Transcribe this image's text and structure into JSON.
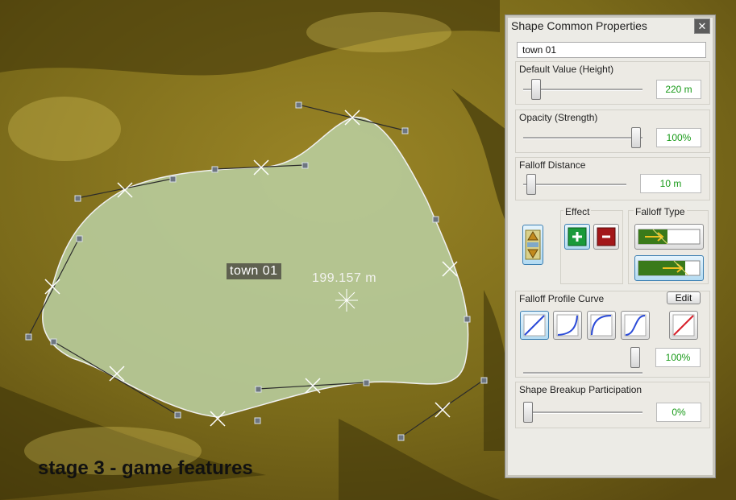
{
  "viewport": {
    "shape_name_tag": "town 01",
    "measurement": "199.157 m",
    "caption": "stage 3 - game features"
  },
  "panel": {
    "title": "Shape Common Properties",
    "close_glyph": "✕",
    "name_value": "town 01",
    "default_value": {
      "label": "Default Value (Height)",
      "value": "220 m",
      "level": 0.08
    },
    "opacity": {
      "label": "Opacity (Strength)",
      "value": "100%",
      "level": 1.0
    },
    "falloff_distance": {
      "label": "Falloff Distance",
      "value": "10 m",
      "level": 0.05
    },
    "effect": {
      "label": "Effect",
      "add_icon": "plus-icon",
      "subtract_icon": "minus-icon"
    },
    "falloff_type": {
      "label": "Falloff Type",
      "selected": "outside"
    },
    "falloff_profile": {
      "label": "Falloff Profile Curve",
      "edit_label": "Edit",
      "curves": [
        "linear",
        "ease-in",
        "ease-out",
        "s-curve",
        "custom"
      ],
      "selected": "linear",
      "value": "100%",
      "level": 1.0
    },
    "shape_breakup": {
      "label": "Shape Breakup Participation",
      "value": "0%",
      "level": 0.0
    }
  },
  "colors": {
    "shape_fill": "#b8cc9c",
    "terrain_base": "#6b5a14",
    "value_text": "#189a18"
  }
}
